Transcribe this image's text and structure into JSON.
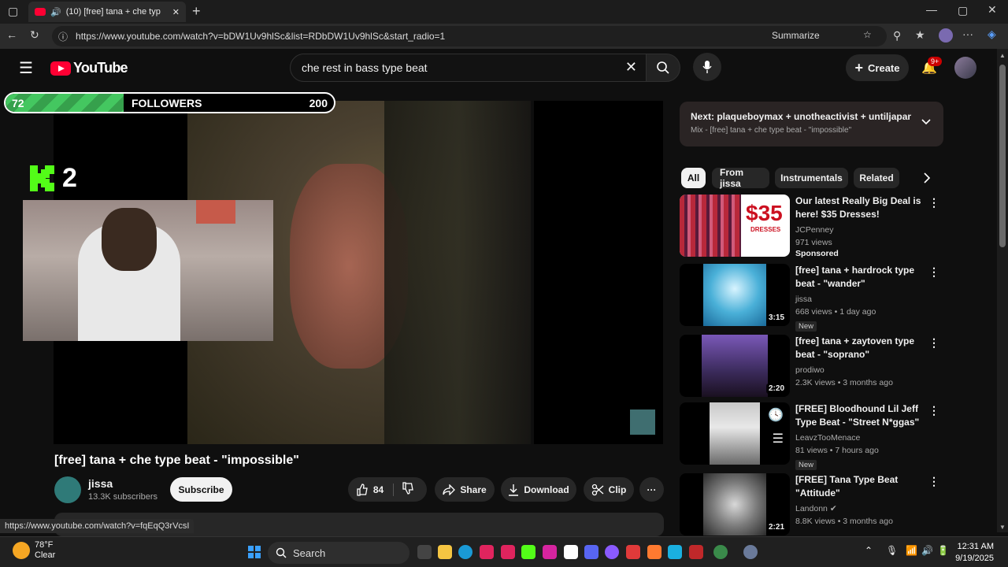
{
  "browser": {
    "tab_title": "(10) [free] tana + che type b",
    "url": "https://www.youtube.com/watch?v=bDW1Uv9hlSc&list=RDbDW1Uv9hlSc&start_radio=1",
    "summarize_label": "Summarize"
  },
  "header": {
    "logo_text": "YouTube",
    "search_value": "che rest in bass type beat",
    "create_label": "Create",
    "notif_badge": "9+"
  },
  "overlay": {
    "followers_current": "72",
    "followers_label": "FOLLOWERS",
    "followers_goal": "200",
    "followers_progress": 0.36,
    "kick_count": "2"
  },
  "video": {
    "title": "[free] tana + che type beat - \"impossible\"",
    "channel": "jissa",
    "subscribers": "13.3K subscribers",
    "subscribe_label": "Subscribe",
    "likes": "84",
    "share_label": "Share",
    "download_label": "Download",
    "clip_label": "Clip"
  },
  "up_next": {
    "title": "Next: plaqueboymax + unotheactivist + untiljapan t...",
    "subtitle": "Mix - [free] tana + che type beat - \"impossible\""
  },
  "chips": [
    "All",
    "From jissa",
    "Instrumentals",
    "Related"
  ],
  "recommendations": [
    {
      "title": "Our latest Really Big Deal is here! $35 Dresses!",
      "channel": "JCPenney",
      "views": "971 views",
      "extra": "Sponsored",
      "duration": "",
      "thumb_text": "$35",
      "thumb_sub": "DRESSES"
    },
    {
      "title": "[free] tana + hardrock type beat - \"wander\"",
      "channel": "jissa",
      "views": "668 views • 1 day ago",
      "extra": "New",
      "duration": "3:15"
    },
    {
      "title": "[free] tana + zaytoven type beat - \"soprano\"",
      "channel": "prodiwo",
      "views": "2.3K views • 3 months ago",
      "extra": "",
      "duration": "2:20"
    },
    {
      "title": "[FREE] Bloodhound Lil Jeff Type Beat - \"Street N*ggas\"",
      "channel": "LeavzTooMenace",
      "views": "81 views • 7 hours ago",
      "extra": "New",
      "duration": ""
    },
    {
      "title": "[FREE] Tana Type Beat \"Attitude\"",
      "channel": "Landonn",
      "views": "8.8K views • 3 months ago",
      "extra": "",
      "duration": "2:21"
    }
  ],
  "status_url": "https://www.youtube.com/watch?v=fqEqQ3rVcsI",
  "taskbar": {
    "temperature": "78°F",
    "condition": "Clear",
    "search_label": "Search",
    "time": "12:31 AM",
    "date": "9/19/2025"
  }
}
